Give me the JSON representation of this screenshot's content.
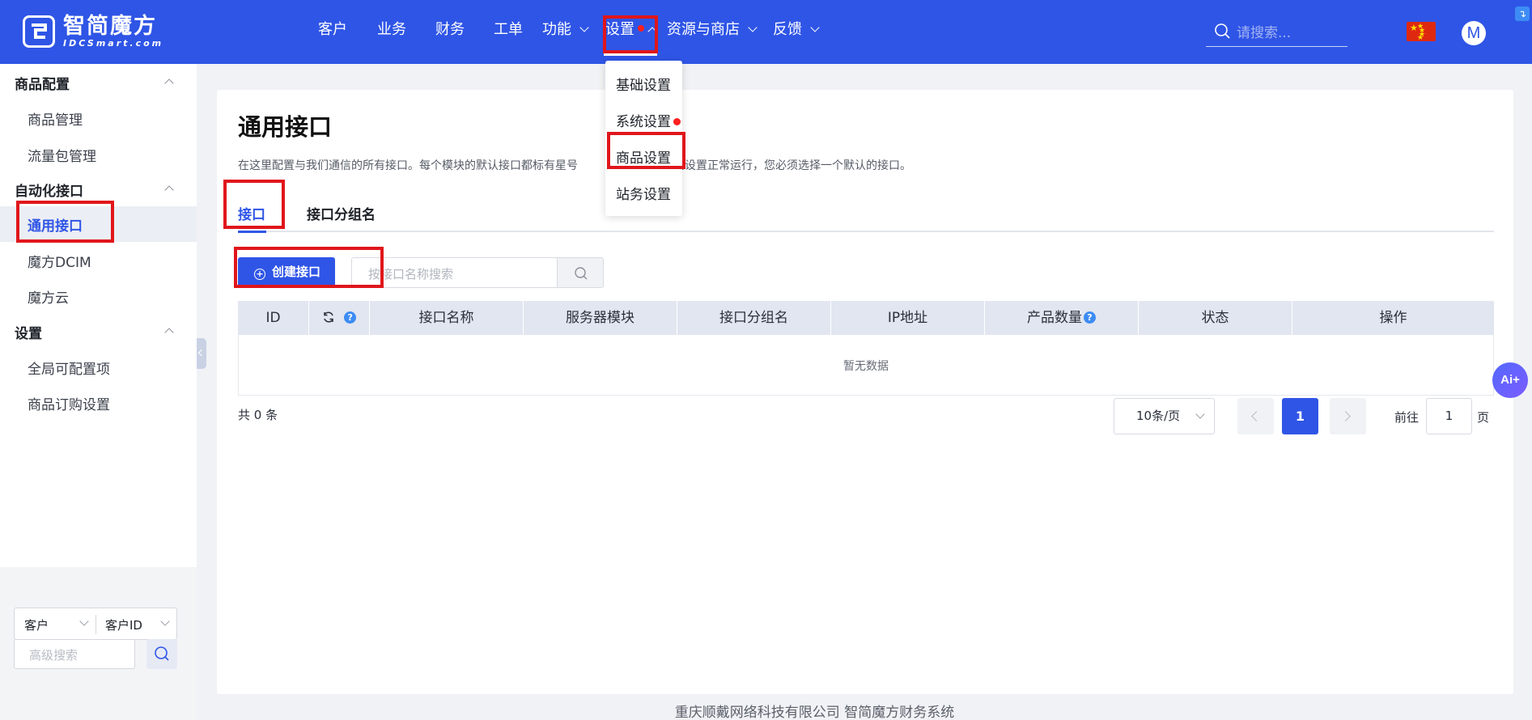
{
  "brand": {
    "name_cn": "智简魔方",
    "name_en": "IDCSmart.com",
    "mark": "ꓛ"
  },
  "nav": {
    "items": [
      {
        "label": "客户"
      },
      {
        "label": "业务"
      },
      {
        "label": "财务"
      },
      {
        "label": "工单"
      },
      {
        "label": "功能"
      },
      {
        "label": "设置"
      },
      {
        "label": "资源与商店"
      },
      {
        "label": "反馈"
      }
    ],
    "active": "设置",
    "search_placeholder": "请搜索...",
    "avatar_letter": "M",
    "settings_menu": [
      {
        "label": "基础设置"
      },
      {
        "label": "系统设置"
      },
      {
        "label": "商品设置"
      },
      {
        "label": "站务设置"
      }
    ]
  },
  "sidebar": {
    "groups": [
      {
        "title": "商品配置",
        "items": [
          {
            "label": "商品管理"
          },
          {
            "label": "流量包管理"
          }
        ]
      },
      {
        "title": "自动化接口",
        "items": [
          {
            "label": "通用接口"
          },
          {
            "label": "魔方DCIM"
          },
          {
            "label": "魔方云"
          }
        ]
      },
      {
        "title": "设置",
        "items": [
          {
            "label": "全局可配置项"
          },
          {
            "label": "商品订购设置"
          }
        ]
      }
    ],
    "active_item": "通用接口",
    "filter": {
      "type": "客户",
      "field": "客户ID",
      "advanced_placeholder": "高级搜索"
    }
  },
  "page": {
    "title": "通用接口",
    "description": "在这里配置与我们通信的所有接口。每个模块的默认接口都标有星号",
    "description_tail": "口自动设置正常运行，您必须选择一个默认的接口。",
    "tabs": [
      {
        "label": "接口"
      },
      {
        "label": "接口分组名"
      }
    ],
    "create_button": "创建接口",
    "search_placeholder": "按接口名称搜索",
    "table": {
      "columns": [
        "ID",
        "",
        "接口名称",
        "服务器模块",
        "接口分组名",
        "IP地址",
        "产品数量",
        "状态",
        "操作"
      ],
      "empty_text": "暂无数据"
    },
    "pagination": {
      "total_label": "共 0 条",
      "page_size": "10条/页",
      "current_page": "1",
      "goto_label": "前往",
      "goto_value": "1",
      "goto_suffix": "页"
    }
  },
  "footer": "重庆顺戴网络科技有限公司 智简魔方财务系统",
  "ai_button": "Ai+",
  "colors": {
    "primary": "#2f55e6",
    "annotation": "#e0161b"
  }
}
